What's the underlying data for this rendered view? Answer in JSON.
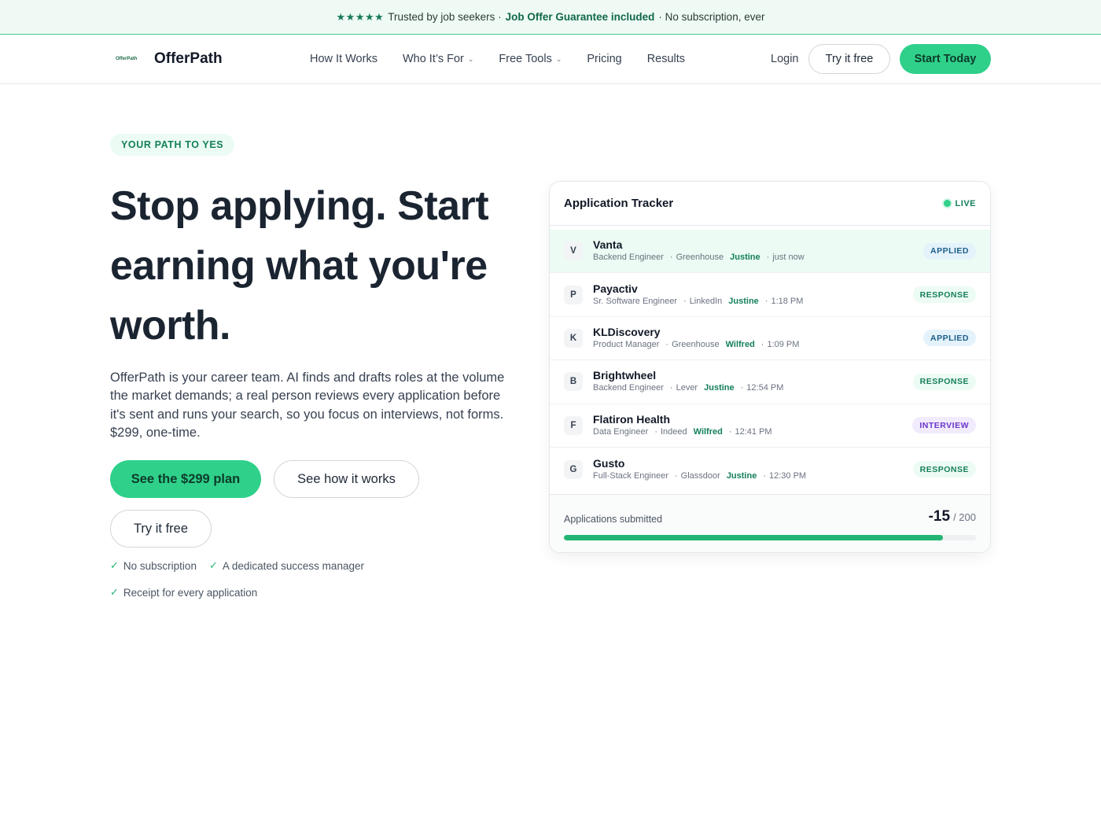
{
  "banner": {
    "stars": "★★★★★",
    "text_before": "Trusted by job seekers ·",
    "highlight": "Job Offer Guarantee included",
    "text_after": "· No subscription, ever"
  },
  "nav": {
    "logo_mark": "OfferPath",
    "logo_text": "OfferPath",
    "links": [
      {
        "label": "How It Works",
        "dropdown": false
      },
      {
        "label": "Who It’s For",
        "dropdown": true
      },
      {
        "label": "Free Tools",
        "dropdown": true
      },
      {
        "label": "Pricing",
        "dropdown": false
      },
      {
        "label": "Results",
        "dropdown": false
      }
    ],
    "login": "Login",
    "try_free": "Try it free",
    "start_today": "Start Today"
  },
  "hero": {
    "eyebrow": "YOUR PATH TO YES",
    "headline": "Stop applying. Start earning what you're worth.",
    "description": "OfferPath is your career team. AI finds and drafts roles at the volume the market demands; a real person reviews every application before it's sent and runs your search, so you focus on interviews, not forms. $299, one-time.",
    "cta_primary": "See the $299 plan",
    "cta_secondary": "See how it works",
    "cta_try": "Try it free",
    "checks": [
      "No subscription",
      "A dedicated success manager",
      "Receipt for every application"
    ]
  },
  "tracker": {
    "title": "Application Tracker",
    "live_label": "LIVE",
    "rows": [
      {
        "initial": "V",
        "company": "Vanta",
        "role": "Backend Engineer",
        "source": "Greenhouse",
        "owner": "Justine",
        "time": "just now",
        "status": "APPLIED",
        "status_type": "applied",
        "highlight": true
      },
      {
        "initial": "P",
        "company": "Payactiv",
        "role": "Sr. Software Engineer",
        "source": "LinkedIn",
        "owner": "Justine",
        "time": "1:18 PM",
        "status": "RESPONSE",
        "status_type": "response",
        "highlight": false
      },
      {
        "initial": "K",
        "company": "KLDiscovery",
        "role": "Product Manager",
        "source": "Greenhouse",
        "owner": "Wilfred",
        "time": "1:09 PM",
        "status": "APPLIED",
        "status_type": "applied",
        "highlight": false
      },
      {
        "initial": "B",
        "company": "Brightwheel",
        "role": "Backend Engineer",
        "source": "Lever",
        "owner": "Justine",
        "time": "12:54 PM",
        "status": "RESPONSE",
        "status_type": "response",
        "highlight": false
      },
      {
        "initial": "F",
        "company": "Flatiron Health",
        "role": "Data Engineer",
        "source": "Indeed",
        "owner": "Wilfred",
        "time": "12:41 PM",
        "status": "INTERVIEW",
        "status_type": "interview",
        "highlight": false
      },
      {
        "initial": "G",
        "company": "Gusto",
        "role": "Full-Stack Engineer",
        "source": "Glassdoor",
        "owner": "Justine",
        "time": "12:30 PM",
        "status": "RESPONSE",
        "status_type": "response",
        "highlight": false
      }
    ],
    "footer_label": "Applications submitted",
    "count": "-15",
    "total": "/ 200",
    "progress": 0.92
  },
  "colors": {
    "accent": "#2fd08a",
    "accent_dark": "#15805a",
    "banner_bg": "#effaf4"
  }
}
